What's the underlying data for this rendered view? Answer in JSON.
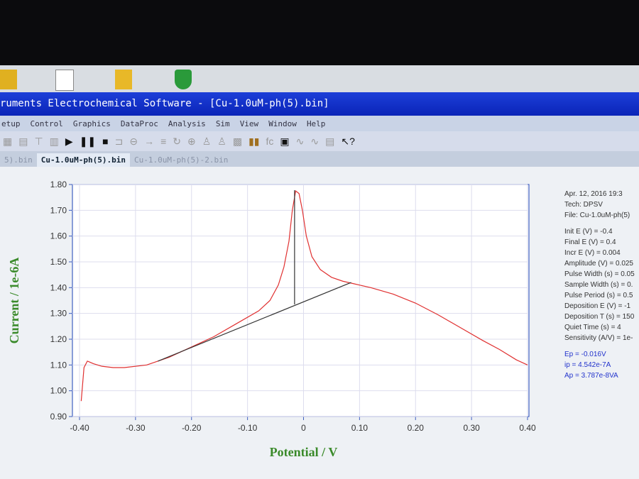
{
  "window": {
    "title": "ruments Electrochemical Software - [Cu-1.0uM-ph(5).bin]"
  },
  "menu": [
    "etup",
    "Control",
    "Graphics",
    "DataProc",
    "Analysis",
    "Sim",
    "View",
    "Window",
    "Help"
  ],
  "tabs": [
    "5).bin",
    "Cu-1.0uM-ph(5).bin",
    "Cu-1.0uM-ph(5)-2.bin"
  ],
  "info": {
    "header": [
      "Apr. 12, 2016   19:3",
      "Tech: DPSV",
      "File: Cu-1.0uM-ph(5)"
    ],
    "params": [
      "Init E (V) = -0.4",
      "Final E (V) = 0.4",
      "Incr E (V) = 0.004",
      "Amplitude (V) = 0.025",
      "Pulse Width (s) = 0.05",
      "Sample Width (s) = 0.",
      "Pulse Period (s) = 0.5",
      "Deposition E (V) = -1",
      "Deposition T (s) = 150",
      "Quiet Time (s) = 4",
      "Sensitivity (A/V) = 1e-"
    ],
    "results": [
      "Ep = -0.016V",
      "ip = 4.542e-7A",
      "Ap = 3.787e-8VA"
    ]
  },
  "chart_data": {
    "type": "line",
    "xlabel": "Potential / V",
    "ylabel": "Current / 1e-6A",
    "xlim": [
      -0.4,
      0.4
    ],
    "ylim": [
      0.9,
      1.8
    ],
    "xticks": [
      -0.4,
      -0.3,
      -0.2,
      -0.1,
      0,
      0.1,
      0.2,
      0.3,
      0.4
    ],
    "xtick_labels": [
      "-0.40",
      "-0.30",
      "-0.20",
      "-0.10",
      "0",
      "0.10",
      "0.20",
      "0.30",
      "0.40"
    ],
    "yticks": [
      0.9,
      1.0,
      1.1,
      1.2,
      1.3,
      1.4,
      1.5,
      1.6,
      1.7,
      1.8
    ],
    "ytick_labels": [
      "0.90",
      "1.00",
      "1.10",
      "1.20",
      "1.30",
      "1.40",
      "1.50",
      "1.60",
      "1.70",
      "1.80"
    ],
    "grid": true,
    "series": [
      {
        "name": "DPSV",
        "color": "#e03030",
        "x": [
          -0.397,
          -0.392,
          -0.386,
          -0.375,
          -0.36,
          -0.34,
          -0.32,
          -0.28,
          -0.24,
          -0.2,
          -0.16,
          -0.12,
          -0.08,
          -0.06,
          -0.045,
          -0.035,
          -0.026,
          -0.02,
          -0.014,
          -0.008,
          -0.002,
          0.005,
          0.015,
          0.03,
          0.05,
          0.07,
          0.09,
          0.12,
          0.16,
          0.2,
          0.24,
          0.28,
          0.32,
          0.35,
          0.38,
          0.4
        ],
        "y": [
          0.96,
          1.09,
          1.115,
          1.105,
          1.095,
          1.09,
          1.09,
          1.1,
          1.13,
          1.17,
          1.21,
          1.26,
          1.31,
          1.35,
          1.41,
          1.48,
          1.58,
          1.7,
          1.775,
          1.765,
          1.7,
          1.6,
          1.52,
          1.47,
          1.44,
          1.425,
          1.415,
          1.4,
          1.375,
          1.34,
          1.295,
          1.245,
          1.195,
          1.16,
          1.12,
          1.1
        ]
      }
    ],
    "baseline": {
      "x": [
        -0.26,
        0.085
      ],
      "y": [
        1.115,
        1.42
      ],
      "color": "#333333"
    },
    "peak_line": {
      "x": -0.016,
      "y": [
        1.335,
        1.778
      ],
      "color": "#333333"
    }
  }
}
